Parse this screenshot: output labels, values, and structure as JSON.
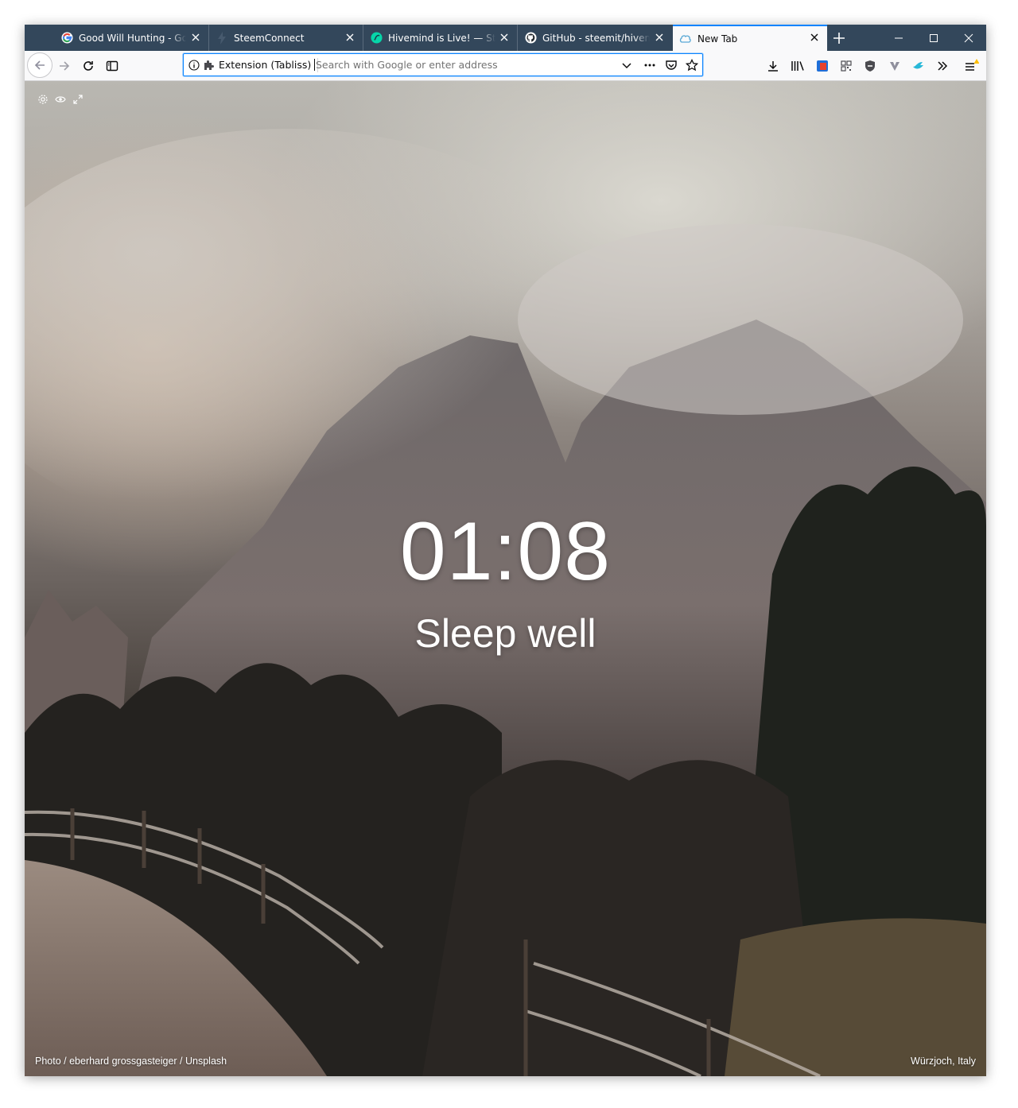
{
  "browser": {
    "tabs": [
      {
        "title": "Good Will Hunting - Google Search",
        "favicon": "google-icon"
      },
      {
        "title": "SteemConnect",
        "favicon": "steemconnect-icon"
      },
      {
        "title": "Hivemind is Live! — Steemit",
        "favicon": "steemit-icon"
      },
      {
        "title": "GitHub - steemit/hivemind",
        "favicon": "github-icon"
      },
      {
        "title": "New Tab",
        "favicon": "tabliss-icon",
        "active": true
      }
    ],
    "accent_color": "#0a84ff",
    "tabstrip_color": "#33475b"
  },
  "urlbar": {
    "identity_label": "Extension (Tabliss)",
    "placeholder": "Search with Google or enter address"
  },
  "page": {
    "time": "01:08",
    "greeting": "Sleep well",
    "photo_credit": "Photo / eberhard grossgasteiger / Unsplash",
    "location": "Würzjoch, Italy"
  }
}
